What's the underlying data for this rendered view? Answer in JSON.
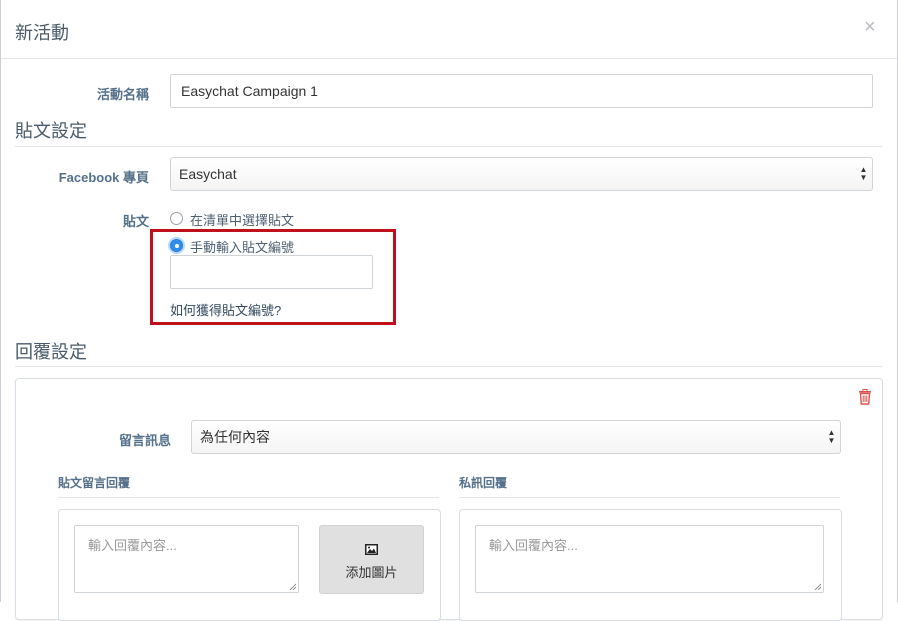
{
  "modal": {
    "title": "新活動",
    "close_symbol": "×"
  },
  "campaign": {
    "label": "活動名稱",
    "value": "Easychat Campaign 1"
  },
  "post_settings": {
    "section_title": "貼文設定",
    "facebook_page": {
      "label": "Facebook 專頁",
      "selected": "Easychat"
    },
    "post": {
      "label": "貼文",
      "option_select_from_list": "在清單中選擇貼文",
      "option_manual_input": "手動輸入貼文編號",
      "post_id_value": "",
      "help_link": "如何獲得貼文編號?"
    }
  },
  "reply_settings": {
    "section_title": "回覆設定",
    "comment_message": {
      "label": "留言訊息",
      "selected": "為任何內容"
    },
    "post_comment_reply": {
      "label": "貼文留言回覆",
      "placeholder": "輸入回覆內容...",
      "add_image_label": "添加圖片"
    },
    "private_message_reply": {
      "label": "私訊回覆",
      "placeholder": "輸入回覆內容..."
    }
  },
  "colors": {
    "highlight": "#c0101b",
    "radio_active": "#2e8ef0",
    "delete": "#d9534f"
  },
  "icons": {
    "close": "close-icon",
    "delete": "trash-icon",
    "image": "image-icon"
  }
}
